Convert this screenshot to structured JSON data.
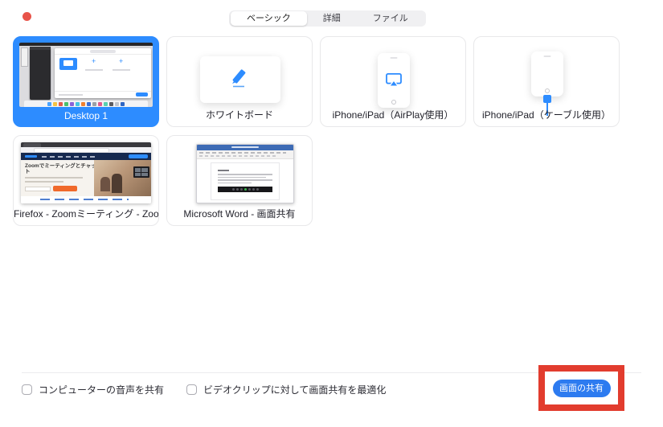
{
  "window": {
    "traffic_light": {
      "close_color": "#e8544a"
    }
  },
  "tabs": {
    "items": [
      {
        "label": "ベーシック",
        "selected": true
      },
      {
        "label": "詳細",
        "selected": false
      },
      {
        "label": "ファイル",
        "selected": false
      }
    ]
  },
  "tiles": [
    {
      "id": "desktop-1",
      "label": "Desktop 1",
      "type": "screen",
      "selected": true
    },
    {
      "id": "whiteboard",
      "label": "ホワイトボード",
      "type": "whiteboard",
      "selected": false
    },
    {
      "id": "iphone-airplay",
      "label": "iPhone/iPad（AirPlay使用）",
      "type": "iphone-airplay",
      "selected": false
    },
    {
      "id": "iphone-cable",
      "label": "iPhone/iPad（ケーブル使用）",
      "type": "iphone-cable",
      "selected": false
    },
    {
      "id": "firefox-window",
      "label": "Firefox - Zoomミーティング - Zoom...",
      "type": "app-window",
      "selected": false
    },
    {
      "id": "word-window",
      "label": "Microsoft Word - 画面共有",
      "type": "app-window",
      "selected": false
    }
  ],
  "thumbnails": {
    "firefox": {
      "heading_line1": "Zoomでミーティングとチャッ",
      "heading_line2": "ト"
    }
  },
  "footer": {
    "checkboxes": [
      {
        "label": "コンピューターの音声を共有",
        "checked": false
      },
      {
        "label": "ビデオクリップに対して画面共有を最適化",
        "checked": false
      }
    ],
    "share_button_label": "画面の共有"
  },
  "colors": {
    "accent_blue": "#2D8CFF",
    "share_button_blue": "#2D7BF0",
    "highlight_red": "#E23C2E",
    "close_dot_red": "#E8544A"
  }
}
